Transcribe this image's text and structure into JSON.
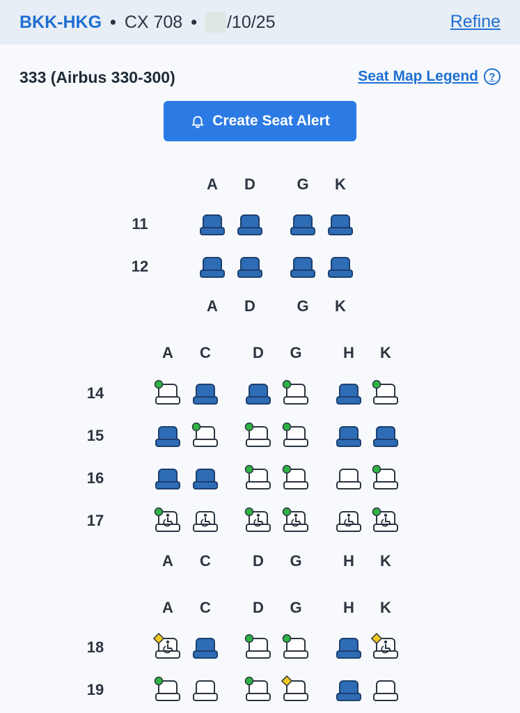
{
  "header": {
    "route": "BKK-HKG",
    "separator": "•",
    "flight": "CX 708",
    "date_suffix": "/10/25",
    "refine_label": "Refine"
  },
  "aircraft_label": "333 (Airbus 330-300)",
  "legend_link_label": "Seat Map Legend",
  "help_glyph": "?",
  "create_alert_label": "Create Seat Alert",
  "colors": {
    "brand": "#1f6fd1",
    "button": "#2c7be5",
    "occupied_seat": "#2e6cb5",
    "available_good": "#2fb344",
    "available_mixed": "#f2c81f"
  },
  "sections": [
    {
      "name": "upper",
      "columns": [
        "A",
        "D",
        "G",
        "K"
      ],
      "footer_columns": [
        "A",
        "D",
        "G",
        "K"
      ],
      "rows": [
        {
          "number": "11",
          "seats": [
            "occupied",
            "occupied",
            "occupied",
            "occupied"
          ]
        },
        {
          "number": "12",
          "seats": [
            "occupied",
            "occupied",
            "occupied",
            "occupied"
          ]
        }
      ]
    },
    {
      "name": "middle",
      "columns": [
        "A",
        "C",
        "D",
        "G",
        "H",
        "K"
      ],
      "footer_columns": [
        "A",
        "C",
        "D",
        "G",
        "H",
        "K"
      ],
      "rows": [
        {
          "number": "14",
          "seats": [
            "avail-green",
            "occupied",
            "occupied",
            "avail-green",
            "occupied",
            "avail-green"
          ]
        },
        {
          "number": "15",
          "seats": [
            "occupied",
            "avail-green",
            "avail-green",
            "avail-green",
            "occupied",
            "occupied"
          ]
        },
        {
          "number": "16",
          "seats": [
            "occupied",
            "occupied",
            "avail-green",
            "avail-green",
            "avail",
            "avail-green"
          ]
        },
        {
          "number": "17",
          "seats": [
            "bassinet-green",
            "bassinet",
            "bassinet-green",
            "bassinet-green",
            "bassinet",
            "bassinet-green"
          ]
        }
      ]
    },
    {
      "name": "lower",
      "columns": [
        "A",
        "C",
        "D",
        "G",
        "H",
        "K"
      ],
      "rows": [
        {
          "number": "18",
          "seats": [
            "bassinet-yellow",
            "occupied",
            "avail-green",
            "avail-green",
            "occupied",
            "bassinet-yellow"
          ]
        },
        {
          "number": "19",
          "seats": [
            "avail-green",
            "avail",
            "avail-green",
            "avail-yellow",
            "occupied",
            "avail"
          ]
        }
      ]
    }
  ]
}
